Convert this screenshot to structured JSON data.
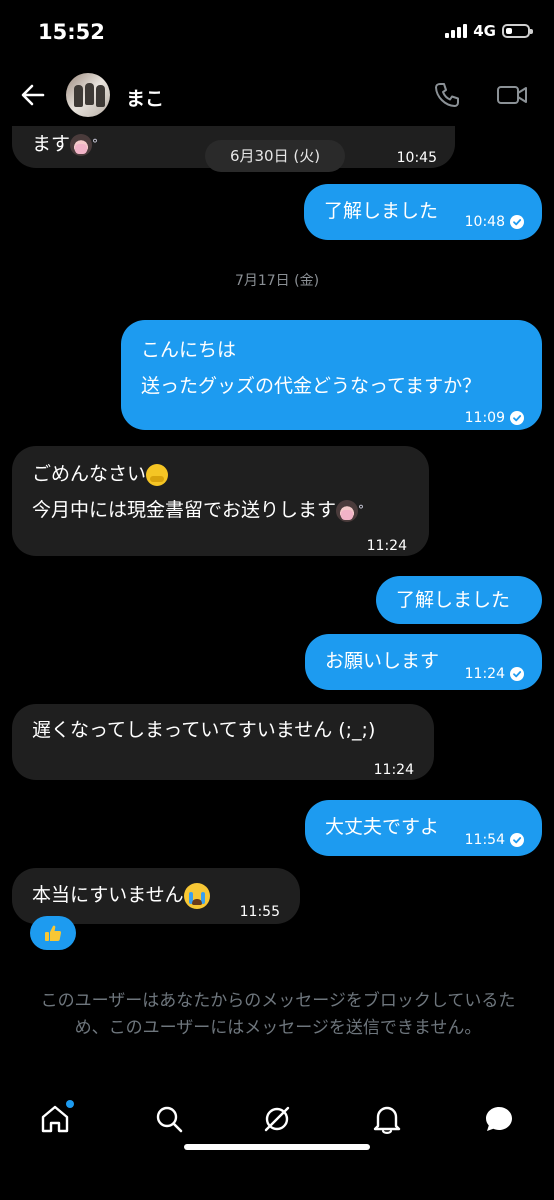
{
  "status": {
    "time": "15:52",
    "network": "4G"
  },
  "header": {
    "contact_name": "まこ"
  },
  "floating_date": "6月30日 (火)",
  "messages": [
    {
      "dir": "in",
      "lines": [
        "ます"
      ],
      "time": "10:45"
    },
    {
      "dir": "out",
      "lines": [
        "了解しました"
      ],
      "time": "10:48"
    },
    {
      "dir": "out",
      "lines": [
        "こんにちは",
        "送ったグッズの代金どうなってますか？"
      ],
      "time": "11:09"
    },
    {
      "dir": "in",
      "lines": [
        "ごめんなさい",
        "今月中には現金書留でお送りします"
      ],
      "time": "11:24"
    },
    {
      "dir": "out",
      "lines": [
        "了解しました"
      ]
    },
    {
      "dir": "out",
      "lines": [
        "お願いします"
      ],
      "time": "11:24"
    },
    {
      "dir": "in",
      "lines": [
        "遅くなってしまっていてすいません (;_;)"
      ],
      "time": "11:24"
    },
    {
      "dir": "out",
      "lines": [
        "大丈夫ですよ"
      ],
      "time": "11:54"
    },
    {
      "dir": "in",
      "lines": [
        "本当にすいません"
      ],
      "time": "11:55"
    }
  ],
  "date_separator": "7月17日 (金)",
  "block_notice": "このユーザーはあなたからのメッセージをブロックしているため、このユーザーにはメッセージを送信できません。",
  "colors": {
    "accent": "#1d9bf0",
    "incoming_bubble": "#1f1f1f",
    "background": "#000000",
    "muted_text": "#6e767d"
  },
  "tabs": [
    "home-icon",
    "search-icon",
    "spaces-icon",
    "notifications-icon",
    "messages-icon"
  ],
  "battery_level": 0.3
}
